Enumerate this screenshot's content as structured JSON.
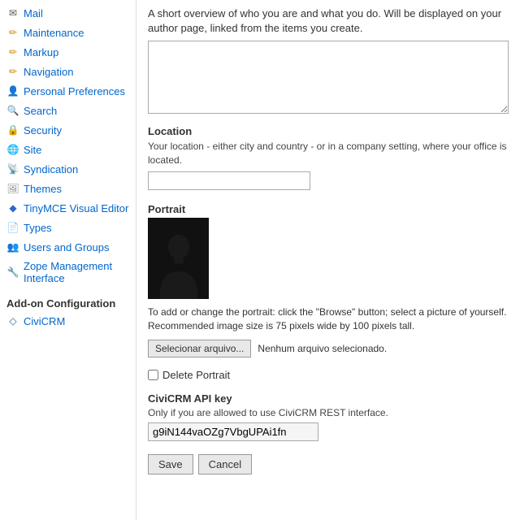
{
  "sidebar": {
    "items": [
      {
        "id": "mail",
        "label": "Mail",
        "icon": "✉",
        "iconClass": "icon-mail"
      },
      {
        "id": "maintenance",
        "label": "Maintenance",
        "icon": "✏",
        "iconClass": "icon-maintenance"
      },
      {
        "id": "markup",
        "label": "Markup",
        "icon": "✏",
        "iconClass": "icon-markup"
      },
      {
        "id": "navigation",
        "label": "Navigation",
        "icon": "✏",
        "iconClass": "icon-navigation"
      },
      {
        "id": "preferences",
        "label": "Personal Preferences",
        "icon": "👤",
        "iconClass": "icon-preferences"
      },
      {
        "id": "search",
        "label": "Search",
        "icon": "🔍",
        "iconClass": "icon-search"
      },
      {
        "id": "security",
        "label": "Security",
        "icon": "🔒",
        "iconClass": "icon-security"
      },
      {
        "id": "site",
        "label": "Site",
        "icon": "🌐",
        "iconClass": "icon-site"
      },
      {
        "id": "syndication",
        "label": "Syndication",
        "icon": "📡",
        "iconClass": "icon-syndication"
      },
      {
        "id": "themes",
        "label": "Themes",
        "icon": "🖼",
        "iconClass": "icon-themes"
      },
      {
        "id": "tinymce",
        "label": "TinyMCE Visual Editor",
        "icon": "◆",
        "iconClass": "icon-tinymce"
      },
      {
        "id": "types",
        "label": "Types",
        "icon": "📄",
        "iconClass": "icon-types"
      },
      {
        "id": "users",
        "label": "Users and Groups",
        "icon": "👥",
        "iconClass": "icon-users"
      },
      {
        "id": "zope",
        "label": "Zope Management Interface",
        "icon": "🔧",
        "iconClass": "icon-zope"
      }
    ],
    "addon_section": "Add-on Configuration",
    "civicrm_label": "CiviCRM"
  },
  "main": {
    "bio_description": "A short overview of who you are and what you do. Will be displayed on your author page, linked from the items you create.",
    "bio_value": "",
    "location_label": "Location",
    "location_description": "Your location - either city and country - or in a company setting, where your office is located.",
    "location_value": "",
    "portrait_label": "Portrait",
    "portrait_info": "To add or change the portrait: click the \"Browse\" button; select a picture of yourself. Recommended image size is 75 pixels wide by 100 pixels tall.",
    "browse_button_label": "Selecionar arquivo...",
    "no_file_text": "Nenhum arquivo selecionado.",
    "delete_portrait_label": "Delete Portrait",
    "api_key_label": "CiviCRM API key",
    "api_key_description": "Only if you are allowed to use CiviCRM REST interface.",
    "api_key_value": "g9iN144vaOZg7VbgUPAi1fn",
    "save_label": "Save",
    "cancel_label": "Cancel"
  }
}
